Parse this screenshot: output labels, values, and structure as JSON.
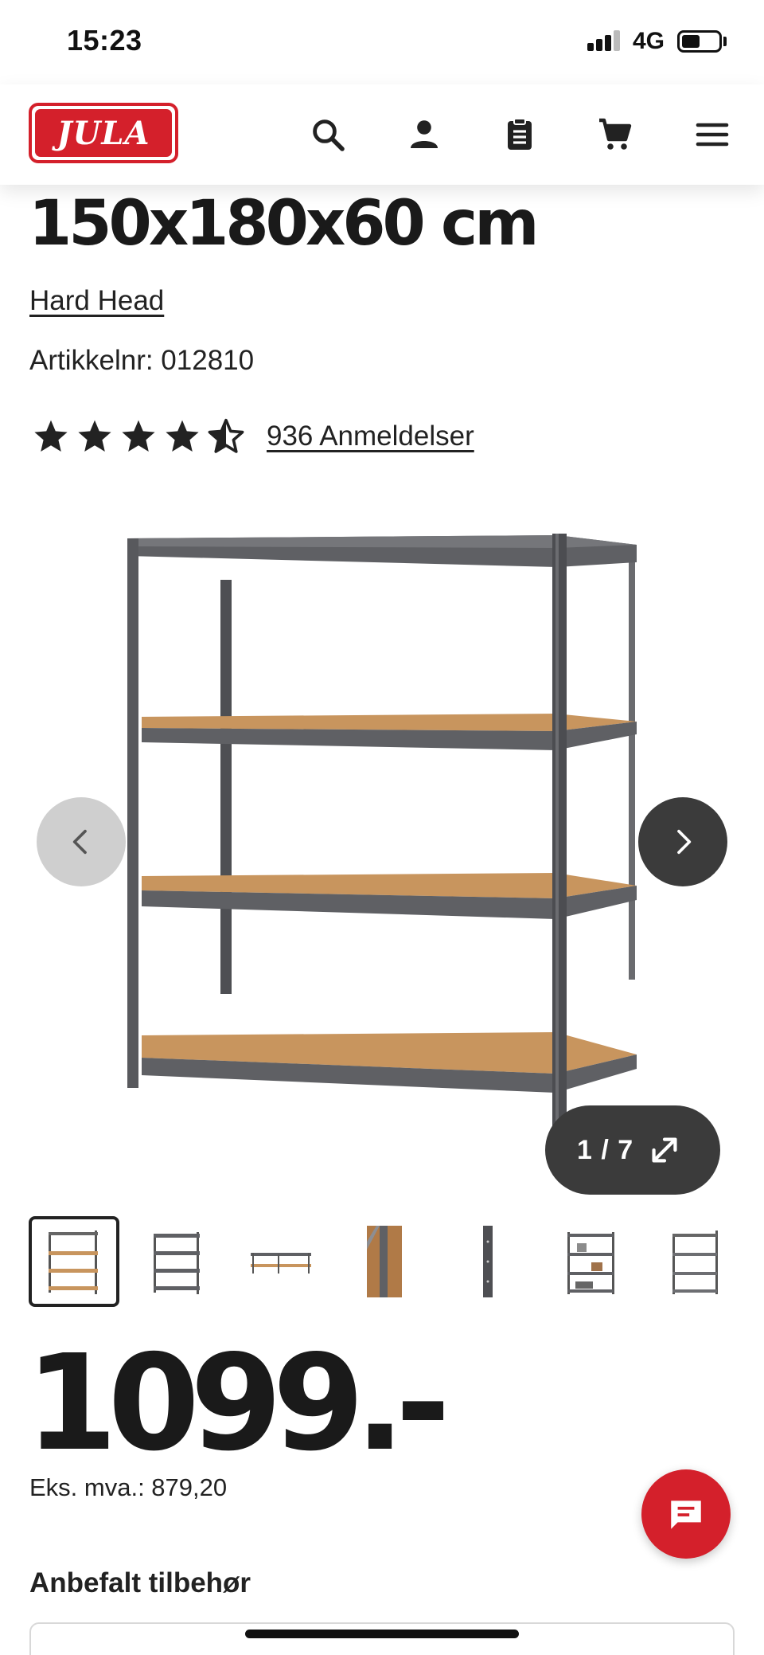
{
  "status_bar": {
    "time": "15:23",
    "network": "4G"
  },
  "header": {
    "logo_text": "JULA",
    "icons": [
      "search-icon",
      "account-icon",
      "shopping-list-icon",
      "cart-icon",
      "menu-icon"
    ]
  },
  "product": {
    "title_visible": "150x180x60 cm",
    "brand": "Hard Head",
    "article_number": "Artikkelnr: 012810",
    "rating_stars": 4.5,
    "reviews_label": "936 Anmeldelser",
    "price": "1099.-",
    "price_ex_vat": "Eks. mva.: 879,20"
  },
  "gallery": {
    "counter": "1 / 7",
    "current_index": 1,
    "total_images": 7
  },
  "sections": {
    "accessories_title": "Anbefalt tilbehør"
  },
  "colors": {
    "brand_red": "#d4202b",
    "dark_control": "#3b3b3b",
    "disabled_control": "#cfcfcf",
    "shelf_wood": "#c8955e",
    "shelf_metal": "#5f6064"
  }
}
